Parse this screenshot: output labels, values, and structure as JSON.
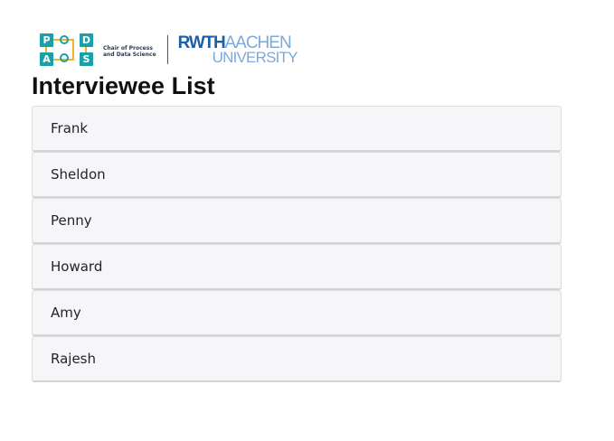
{
  "header": {
    "pads_logo": {
      "tiles": [
        "P",
        "D",
        "A",
        "S"
      ],
      "caption_line1": "Chair of Process",
      "caption_line2": "and Data Science"
    },
    "rwth_logo": {
      "top_strong": "RWTH",
      "top_light": "AACHEN",
      "bottom": "UNIVERSITY"
    }
  },
  "main": {
    "title": "Interviewee List",
    "interviewees": [
      {
        "name": "Frank"
      },
      {
        "name": "Sheldon"
      },
      {
        "name": "Penny"
      },
      {
        "name": "Howard"
      },
      {
        "name": "Amy"
      },
      {
        "name": "Rajesh"
      }
    ]
  },
  "colors": {
    "pads_teal": "#19a0a8",
    "pads_yellow": "#f3b424",
    "rwth_blue": "#1d5ea6",
    "rwth_light_blue": "#7fa8d8",
    "list_item_bg": "#f6f6f8"
  }
}
